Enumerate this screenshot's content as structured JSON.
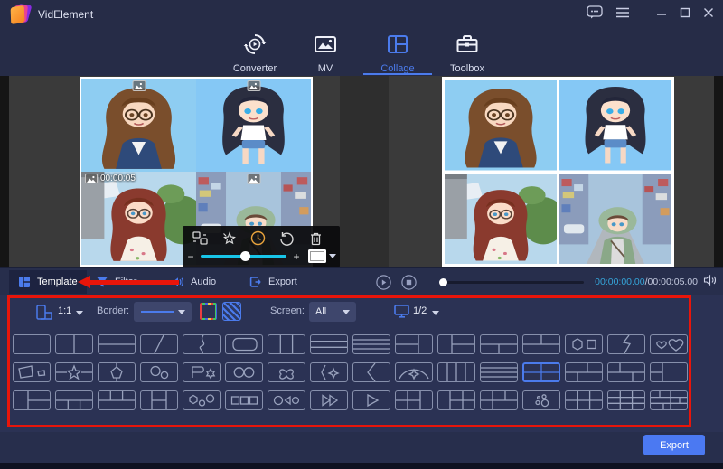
{
  "colors": {
    "accent": "#4b7bec",
    "annotation_red": "#e8150a",
    "selection_yellow": "#f2e410",
    "warning_red_dashed": "#e85040",
    "slider_cyan": "#18c5e8",
    "duration_orange": "#e8a33c"
  },
  "titlebar": {
    "app_title": "VidElement",
    "window_icons": [
      "feedback-icon",
      "menu-icon",
      "minimize-icon",
      "maximize-icon",
      "close-icon"
    ]
  },
  "nav": {
    "items": [
      {
        "label": "Converter",
        "icon": "converter-icon",
        "active": false
      },
      {
        "label": "MV",
        "icon": "mv-icon",
        "active": false
      },
      {
        "label": "Collage",
        "icon": "collage-icon",
        "active": true
      },
      {
        "label": "Toolbox",
        "icon": "toolbox-icon",
        "active": false
      }
    ]
  },
  "editor": {
    "cells": [
      "portrait-woman-glasses",
      "chibi-girl-dark-hair",
      "girl-auburn-outdoor",
      "girl-green-hood-street"
    ],
    "selected_clip": {
      "duration": "00:00:05"
    },
    "toolbar": [
      "swap-icon",
      "effects-icon",
      "duration-icon",
      "rotate-icon",
      "delete-icon"
    ],
    "zoom_out": "−",
    "zoom_in": "+"
  },
  "tabs": [
    {
      "label": "Template",
      "icon": "template-icon",
      "active": true
    },
    {
      "label": "Filter",
      "icon": "filter-icon",
      "active": false
    },
    {
      "label": "Audio",
      "icon": "audio-icon",
      "active": false
    },
    {
      "label": "Export",
      "icon": "export-tab-icon",
      "active": false
    }
  ],
  "playback": {
    "current_time": "00:00:00.00",
    "separator": "/",
    "total_time": "00:00:05.00"
  },
  "template_options": {
    "aspect_ratio": "1:1",
    "border_label": "Border:",
    "screen_label": "Screen:",
    "screen_value": "All",
    "page_indicator": "1/2"
  },
  "templates": {
    "rows": [
      [
        "single",
        "two-columns",
        "two-rows",
        "diagonal",
        "curve-split",
        "rounded-frame",
        "three-columns",
        "three-rows",
        "four-rows",
        "left-stack-right-panel",
        "left-panel-right-stack",
        "top-panel-bottom-split",
        "top-split-bottom-panel",
        "hexagon-square",
        "lightning-split",
        "hearts"
      ],
      [
        "megaphone",
        "star-banner",
        "pentagon",
        "two-circles",
        "flag-gear",
        "double-circles",
        "clover",
        "star-bracket",
        "chevron-split",
        "arch-star",
        "four-columns",
        "four-rows-stripes",
        "grid-2x2",
        "grid-2x2-offset",
        "grid-2x2-stagger",
        "left-column-right-panel"
      ],
      [
        "left-panel-right-rows",
        "top-panel-bottom-three",
        "top-three-bottom-panel",
        "three-columns-center-split",
        "hex-circles",
        "three-squares",
        "circle-triangle-circle",
        "fast-forward",
        "play-split",
        "grid-2x3-left",
        "grid-2x3-right",
        "grid-2x3-top",
        "dots-circles",
        "grid-2x3",
        "grid-3x3",
        "mosaic-grid"
      ]
    ],
    "selected": {
      "row": 1,
      "index": 12
    }
  },
  "bottombar": {
    "export_label": "Export"
  }
}
